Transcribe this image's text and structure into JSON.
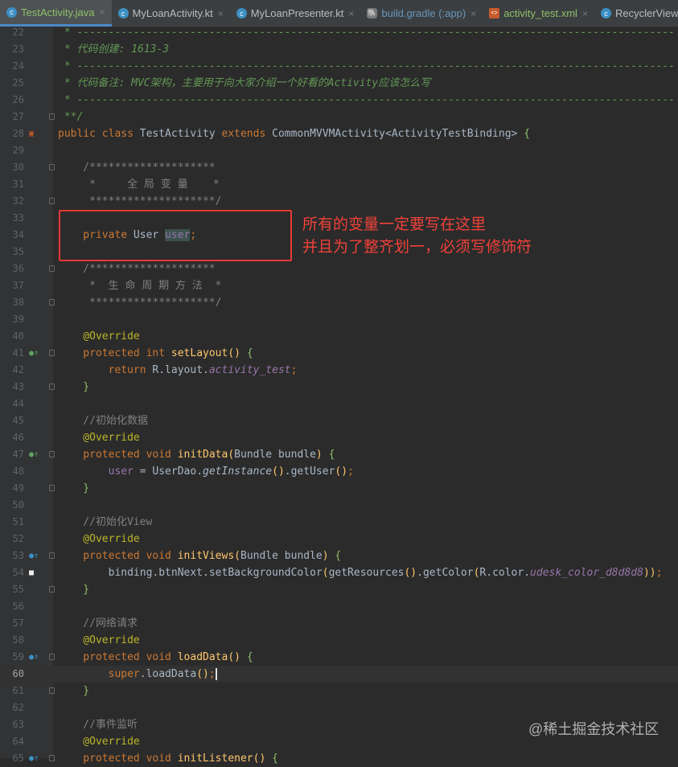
{
  "tabs": [
    {
      "label": "TestActivity.java",
      "active": true
    },
    {
      "label": "MyLoanActivity.kt"
    },
    {
      "label": "MyLoanPresenter.kt"
    },
    {
      "label": "build.gradle (:app)"
    },
    {
      "label": "activity_test.xml"
    },
    {
      "label": "RecyclerView"
    }
  ],
  "annotation": {
    "line1": "所有的变量一定要写在这里",
    "line2": "并且为了整齐划一，必须写修饰符"
  },
  "watermark": "@稀土掘金技术社区",
  "lines": [
    {
      "n": "22",
      "t": [
        [
          "d",
          " * -----------------------------------------------------------------------------------------------"
        ]
      ]
    },
    {
      "n": "23",
      "t": [
        [
          "d",
          " * 代码创建: 1613-3"
        ]
      ]
    },
    {
      "n": "24",
      "t": [
        [
          "d",
          " * -----------------------------------------------------------------------------------------------"
        ]
      ]
    },
    {
      "n": "25",
      "t": [
        [
          "d",
          " * 代码备注: MVC架构，主要用于向大家介绍一个好看的Activity应该怎么写"
        ]
      ]
    },
    {
      "n": "26",
      "t": [
        [
          "d",
          " * -----------------------------------------------------------------------------------------------"
        ]
      ]
    },
    {
      "n": "27",
      "t": [
        [
          "d",
          " **/"
        ]
      ],
      "fold": true
    },
    {
      "n": "28",
      "t": [
        [
          "k",
          "public class "
        ],
        [
          "",
          "TestActivity "
        ],
        [
          "k",
          "extends "
        ],
        [
          "",
          "CommonMVVMActivity<ActivityTestBinding> "
        ],
        [
          "b",
          "{"
        ]
      ],
      "mark": "xml"
    },
    {
      "n": "29",
      "t": []
    },
    {
      "n": "30",
      "t": [
        [
          "c",
          "    /********************"
        ]
      ],
      "fold": true
    },
    {
      "n": "31",
      "t": [
        [
          "c",
          "     *     全 局 变 量    *"
        ]
      ]
    },
    {
      "n": "32",
      "t": [
        [
          "c",
          "     ********************/"
        ]
      ],
      "fold": true
    },
    {
      "n": "33",
      "t": []
    },
    {
      "n": "34",
      "t": [
        [
          "k",
          "    private "
        ],
        [
          "",
          "User "
        ],
        [
          "p hl",
          "user"
        ],
        [
          "k",
          ";"
        ]
      ]
    },
    {
      "n": "35",
      "t": []
    },
    {
      "n": "36",
      "t": [
        [
          "c",
          "    /********************"
        ]
      ],
      "fold": true
    },
    {
      "n": "37",
      "t": [
        [
          "c",
          "     *  生 命 周 期 方 法  *"
        ]
      ]
    },
    {
      "n": "38",
      "t": [
        [
          "c",
          "     ********************/"
        ]
      ],
      "fold": true
    },
    {
      "n": "39",
      "t": []
    },
    {
      "n": "40",
      "t": [
        [
          "a",
          "    @Override"
        ]
      ]
    },
    {
      "n": "41",
      "t": [
        [
          "k",
          "    protected int "
        ],
        [
          "f",
          "setLayout"
        ],
        [
          "f",
          "() "
        ],
        [
          "b",
          "{"
        ]
      ],
      "mark": "impl",
      "fold": true
    },
    {
      "n": "42",
      "t": [
        [
          "k",
          "        return "
        ],
        [
          "",
          "R.layout."
        ],
        [
          "pi",
          "activity_test"
        ],
        [
          "k",
          ";"
        ]
      ]
    },
    {
      "n": "43",
      "t": [
        [
          "b",
          "    }"
        ]
      ],
      "fold": true
    },
    {
      "n": "44",
      "t": []
    },
    {
      "n": "45",
      "t": [
        [
          "c",
          "    //初始化数据"
        ]
      ]
    },
    {
      "n": "46",
      "t": [
        [
          "a",
          "    @Override"
        ]
      ]
    },
    {
      "n": "47",
      "t": [
        [
          "k",
          "    protected void "
        ],
        [
          "f",
          "initData"
        ],
        [
          "f",
          "("
        ],
        [
          "",
          "Bundle bundle"
        ],
        [
          "f",
          ") "
        ],
        [
          "b",
          "{"
        ]
      ],
      "mark": "impl",
      "fold": true
    },
    {
      "n": "48",
      "t": [
        [
          "p",
          "        user "
        ],
        [
          "",
          "= UserDao."
        ],
        [
          "i",
          "getInstance"
        ],
        [
          "f",
          "()"
        ],
        [
          "",
          ".getUser"
        ],
        [
          "f",
          "()"
        ],
        [
          "k",
          ";"
        ]
      ]
    },
    {
      "n": "49",
      "t": [
        [
          "b",
          "    }"
        ]
      ],
      "fold": true
    },
    {
      "n": "50",
      "t": []
    },
    {
      "n": "51",
      "t": [
        [
          "c",
          "    //初始化View"
        ]
      ]
    },
    {
      "n": "52",
      "t": [
        [
          "a",
          "    @Override"
        ]
      ]
    },
    {
      "n": "53",
      "t": [
        [
          "k",
          "    protected void "
        ],
        [
          "f",
          "initViews"
        ],
        [
          "f",
          "("
        ],
        [
          "",
          "Bundle bundle"
        ],
        [
          "f",
          ") "
        ],
        [
          "b",
          "{"
        ]
      ],
      "mark": "over",
      "fold": true
    },
    {
      "n": "54",
      "t": [
        [
          "",
          "        binding.btnNext.setBackgroundColor"
        ],
        [
          "f",
          "("
        ],
        [
          "",
          "getResources"
        ],
        [
          "f",
          "()"
        ],
        [
          "",
          ".getColor"
        ],
        [
          "f",
          "("
        ],
        [
          "",
          "R.color."
        ],
        [
          "pi",
          "udesk_color_d8d8d8"
        ],
        [
          "f",
          "))"
        ],
        [
          "k",
          ";"
        ]
      ],
      "mark": "sq"
    },
    {
      "n": "55",
      "t": [
        [
          "b",
          "    }"
        ]
      ],
      "fold": true
    },
    {
      "n": "56",
      "t": []
    },
    {
      "n": "57",
      "t": [
        [
          "c",
          "    //网络请求"
        ]
      ]
    },
    {
      "n": "58",
      "t": [
        [
          "a",
          "    @Override"
        ]
      ]
    },
    {
      "n": "59",
      "t": [
        [
          "k",
          "    protected void "
        ],
        [
          "f",
          "loadData"
        ],
        [
          "f",
          "() "
        ],
        [
          "b",
          "{"
        ]
      ],
      "mark": "over",
      "fold": true
    },
    {
      "n": "60",
      "t": [
        [
          "k",
          "        super"
        ],
        [
          "",
          ".loadData"
        ],
        [
          "f",
          "()"
        ],
        [
          "k caret",
          ";"
        ]
      ],
      "cur": true
    },
    {
      "n": "61",
      "t": [
        [
          "b",
          "    }"
        ]
      ],
      "fold": true
    },
    {
      "n": "62",
      "t": []
    },
    {
      "n": "63",
      "t": [
        [
          "c",
          "    //事件监听"
        ]
      ]
    },
    {
      "n": "64",
      "t": [
        [
          "a",
          "    @Override"
        ]
      ]
    },
    {
      "n": "65",
      "t": [
        [
          "k",
          "    protected void "
        ],
        [
          "f",
          "initListener"
        ],
        [
          "f",
          "() "
        ],
        [
          "b",
          "{"
        ]
      ],
      "mark": "over",
      "fold": true
    }
  ]
}
